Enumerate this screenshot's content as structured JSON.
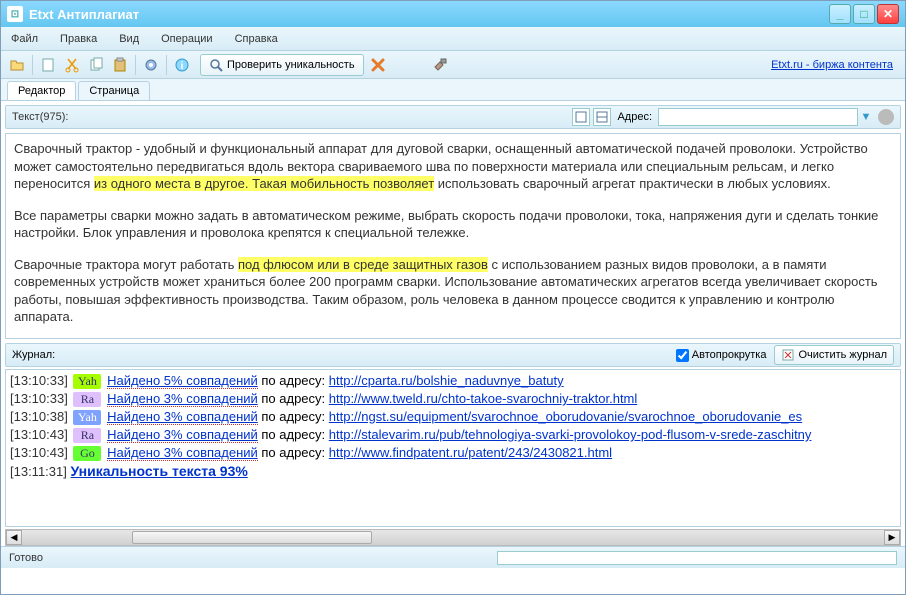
{
  "window": {
    "title": "Etxt Антиплагиат"
  },
  "menu": {
    "file": "Файл",
    "edit": "Правка",
    "view": "Вид",
    "ops": "Операции",
    "help": "Справка"
  },
  "toolbar": {
    "check_label": "Проверить уникальность",
    "exchange_link": "Etxt.ru - биржа контента"
  },
  "tabs": {
    "editor": "Редактор",
    "page": "Страница"
  },
  "subbar": {
    "text_label": "Текст(975):",
    "addr_label": "Адрес:",
    "addr_value": ""
  },
  "editor": {
    "p1_a": "Сварочный трактор - удобный и функциональный аппарат для дуговой сварки, оснащенный автоматической подачей проволоки. Устройство может самостоятельно передвигаться вдоль вектора свариваемого шва по поверхности материала или специальным рельсам, и легко переносится ",
    "p1_h": "из одного места в другое. Такая мобильность позволяет",
    "p1_b": " использовать сварочный агрегат практически в любых условиях.",
    "p2": "Все параметры сварки можно задать в автоматическом режиме, выбрать скорость подачи проволоки, тока, напряжения дуги и сделать тонкие настройки. Блок управления и проволока крепятся к специальной тележке.",
    "p3_a": "Сварочные трактора могут работать ",
    "p3_h": "под флюсом или в среде защитных газов",
    "p3_b": " с использованием разных видов проволоки, а в памяти современных устройств может храниться более 200 программ сварки. Использование автоматических агрегатов всегда увеличивает скорость работы, повышая эффективность производства. Таким образом, роль человека в данном процессе сводится к управлению и контролю аппарата."
  },
  "log": {
    "label": "Журнал:",
    "autoscroll": "Автопрокрутка",
    "clear": "Очистить журнал",
    "addr_prefix": " по адресу: ",
    "rows": [
      {
        "ts": "[13:10:33]",
        "badge": "Yah",
        "bcls": "b-yah",
        "found": "Найдено 5% совпадений",
        "url": "http://cparta.ru/bolshie_naduvnye_batuty"
      },
      {
        "ts": "[13:10:33]",
        "badge": "Ra",
        "bcls": "b-ra",
        "found": "Найдено 3% совпадений",
        "url": "http://www.tweld.ru/chto-takoe-svarochniy-traktor.html"
      },
      {
        "ts": "[13:10:38]",
        "badge": "Yah",
        "bcls": "b-yahb",
        "found": "Найдено 3% совпадений",
        "url": "http://ngst.su/equipment/svarochnoe_oborudovanie/svarochnoe_oborudovanie_es"
      },
      {
        "ts": "[13:10:43]",
        "badge": "Ra",
        "bcls": "b-ra",
        "found": "Найдено 3% совпадений",
        "url": "http://stalevarim.ru/pub/tehnologiya-svarki-provolokoy-pod-flusom-v-srede-zaschitny"
      },
      {
        "ts": "[13:10:43]",
        "badge": "Go",
        "bcls": "b-go",
        "found": "Найдено 3% совпадений",
        "url": "http://www.findpatent.ru/patent/243/2430821.html"
      }
    ],
    "final_ts": "[13:11:31]",
    "final_text": "Уникальность текста 93%"
  },
  "status": {
    "ready": "Готово"
  }
}
